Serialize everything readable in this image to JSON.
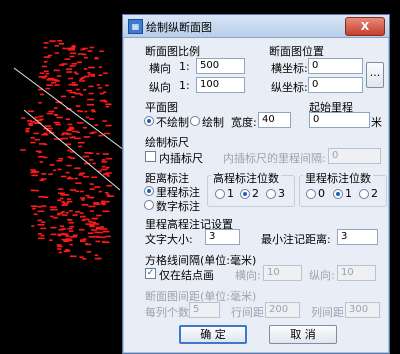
{
  "dialog": {
    "title": "绘制纵断面图",
    "close_label": "X"
  },
  "scale": {
    "title": "断面图比例",
    "horizontal_label": "横向",
    "horizontal_prefix": "1:",
    "horizontal_value": "500",
    "vertical_label": "纵向",
    "vertical_prefix": "1:",
    "vertical_value": "100"
  },
  "position": {
    "title": "断面图位置",
    "x_label": "横坐标:",
    "x_value": "0",
    "y_label": "纵坐标:",
    "y_value": "0",
    "browse_label": "..."
  },
  "plan": {
    "title": "平面图",
    "no_draw_label": "不绘制",
    "draw_label": "绘制",
    "width_label": "宽度:",
    "width_value": "40"
  },
  "start_mileage": {
    "title": "起始里程",
    "value": "0",
    "unit": "米"
  },
  "ruler": {
    "title": "绘制标尺",
    "internal_label": "内插标尺",
    "interval_label": "内插标尺的里程间隔:",
    "interval_value": "0"
  },
  "distance": {
    "title": "距离标注",
    "mileage_label": "里程标注",
    "number_label": "数字标注"
  },
  "elevation_digits": {
    "title": "高程标注位数",
    "options": [
      "1",
      "2",
      "3"
    ]
  },
  "mileage_digits": {
    "title": "里程标注位数",
    "options": [
      "0",
      "1",
      "2"
    ]
  },
  "note_settings": {
    "title": "里程高程注记设置",
    "text_size_label": "文字大小:",
    "text_size_value": "3",
    "min_distance_label": "最小注记距离:",
    "min_distance_value": "3"
  },
  "grid": {
    "title": "方格线间隔(单位:毫米)",
    "only_nodes_label": "仅在结点画",
    "horizontal_label": "横向:",
    "horizontal_value": "10",
    "vertical_label": "纵向:",
    "vertical_value": "10"
  },
  "spacing": {
    "title": "断面图间距(单位:毫米)",
    "per_column_label": "每列个数",
    "per_column_value": "5",
    "row_spacing_label": "行间距",
    "row_spacing_value": "200",
    "col_spacing_label": "列间距",
    "col_spacing_value": "300"
  },
  "buttons": {
    "ok": "确  定",
    "cancel": "取  消"
  },
  "colors": {
    "cad_background": "#000000",
    "cad_points": "#ff1a1a",
    "cad_line": "#e6e6e6"
  }
}
